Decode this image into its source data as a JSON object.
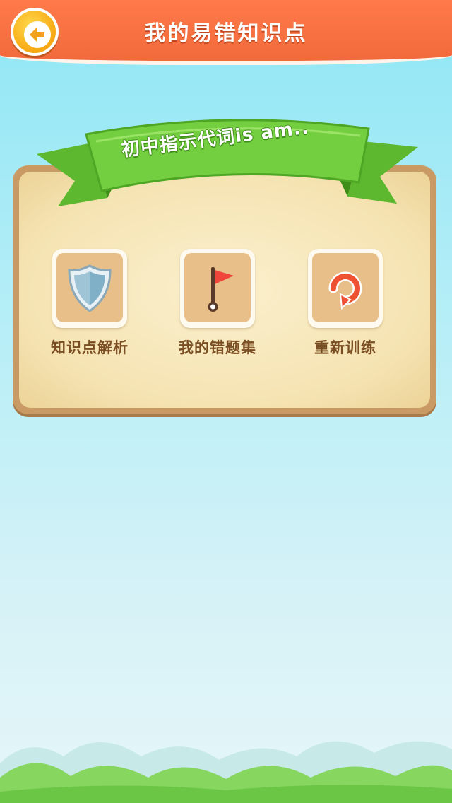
{
  "header": {
    "title": "我的易错知识点",
    "back_icon": "back-arrow-icon"
  },
  "banner": {
    "text": "初中指示代词is am.."
  },
  "options": [
    {
      "label": "知识点解析",
      "icon": "shield-icon"
    },
    {
      "label": "我的错题集",
      "icon": "flag-icon"
    },
    {
      "label": "重新训练",
      "icon": "refresh-icon"
    }
  ],
  "colors": {
    "header": "#f06a3c",
    "back_button": "#f7a812",
    "ribbon": "#6cc93a",
    "panel_border": "#c99a63",
    "panel_fill": "#f5e3b2",
    "label_text": "#7a4e22"
  }
}
